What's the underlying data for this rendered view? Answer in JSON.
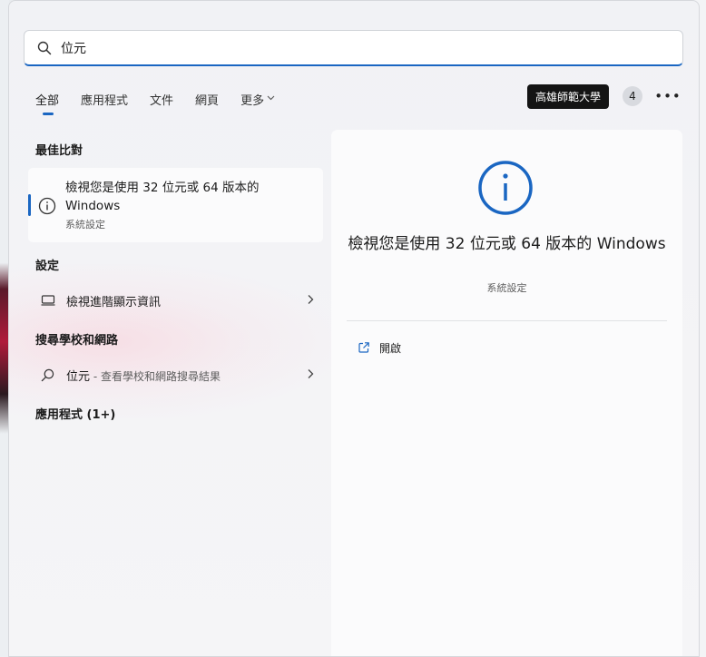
{
  "search": {
    "value": "位元",
    "placeholder": ""
  },
  "tabs": [
    {
      "label": "全部",
      "active": true
    },
    {
      "label": "應用程式"
    },
    {
      "label": "文件"
    },
    {
      "label": "網頁"
    },
    {
      "label": "更多"
    }
  ],
  "header": {
    "org_badge": "高雄師範大學",
    "count": "4",
    "more_label": "•••"
  },
  "sections": {
    "best_match": "最佳比對",
    "settings": "設定",
    "web": "搜尋學校和網路",
    "apps": "應用程式 (1+)"
  },
  "best_match": {
    "title": "檢視您是使用 32 位元或 64 版本的 Windows",
    "subtitle": "系統設定"
  },
  "settings_items": [
    {
      "label": "檢視進階顯示資訊"
    }
  ],
  "web_items": [
    {
      "query": "位元",
      "suffix": " - 查看學校和網路搜尋結果"
    }
  ],
  "detail": {
    "title": "檢視您是使用 32 位元或 64 版本的 Windows",
    "subtitle": "系統設定",
    "actions": [
      {
        "label": "開啟",
        "icon": "open-external-icon"
      }
    ]
  },
  "colors": {
    "accent": "#1a66c2",
    "badge_bg": "#141414"
  }
}
